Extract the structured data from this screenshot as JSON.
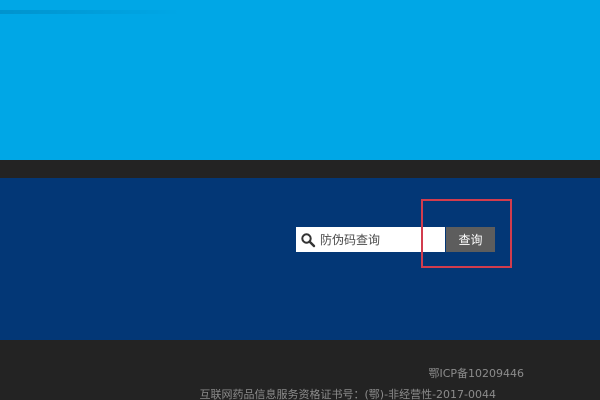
{
  "query": {
    "placeholder": "防伪码查询",
    "button_label": "查询",
    "icon": "search-icon"
  },
  "footer": {
    "icp": "鄂ICP备10209446",
    "license": "互联网药品信息服务资格证书号：(鄂)-非经营性-2017-0044"
  },
  "colors": {
    "banner": "#00a7e6",
    "section": "#033776",
    "footer": "#232323",
    "button": "#5d5d5d",
    "highlight": "#d23c4d"
  }
}
